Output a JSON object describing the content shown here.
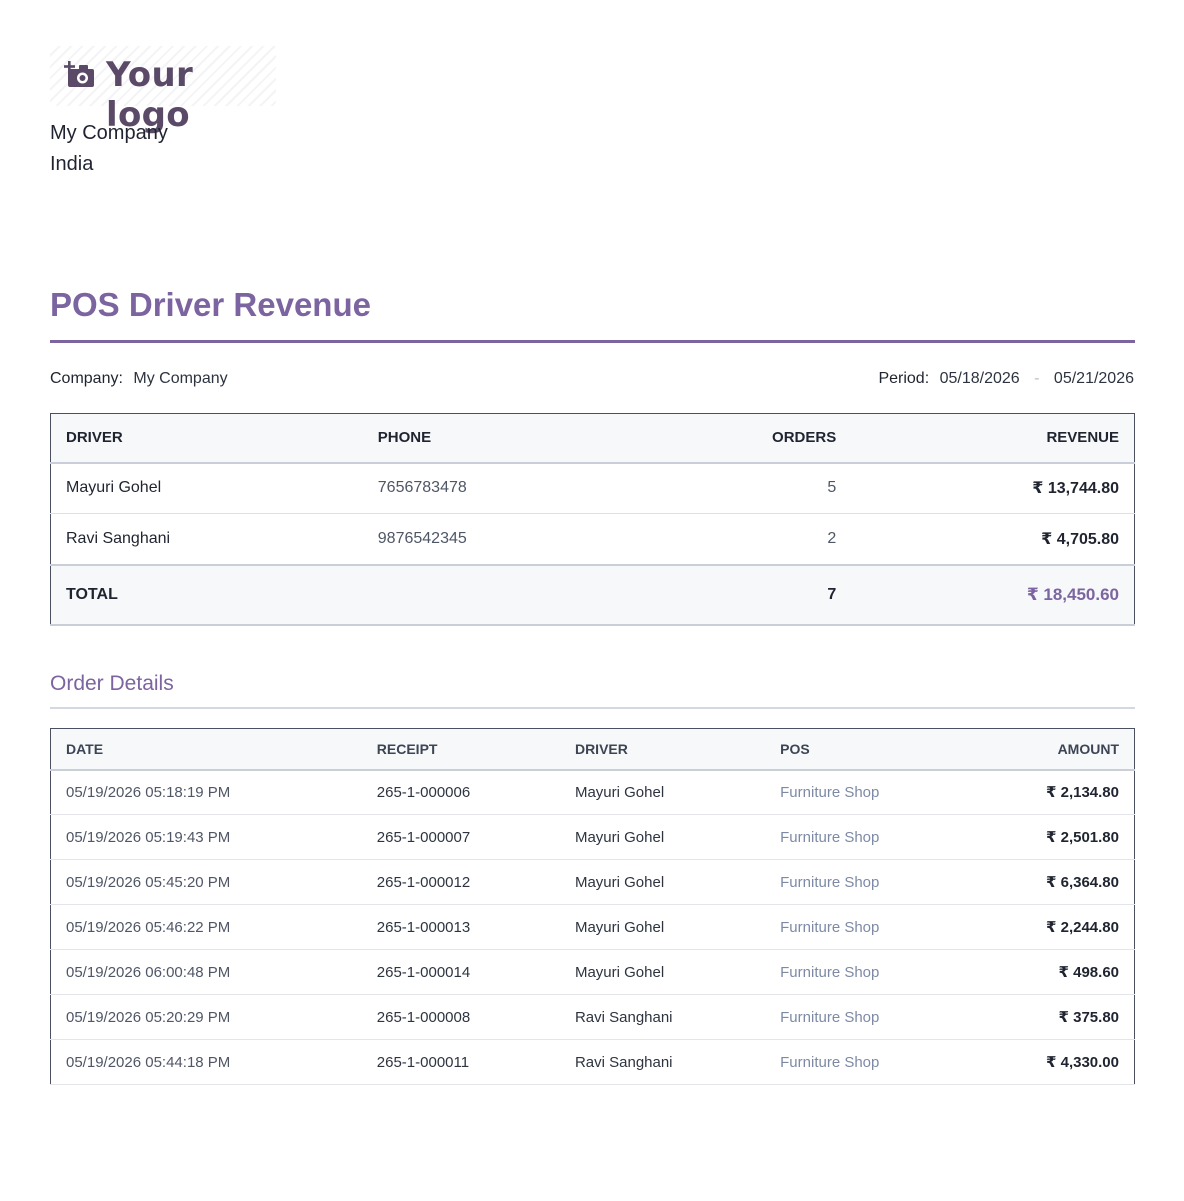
{
  "logo": {
    "text": "Your logo",
    "icon": "camera-plus-icon"
  },
  "company_block": {
    "name": "My Company",
    "country": "India"
  },
  "report": {
    "title": "POS Driver Revenue",
    "company_label": "Company:",
    "company_value": "My Company",
    "period_label": "Period:",
    "period_start": "05/18/2026",
    "period_separator": "-",
    "period_end": "05/21/2026"
  },
  "summary": {
    "headers": {
      "driver": "DRIVER",
      "phone": "PHONE",
      "orders": "ORDERS",
      "revenue": "REVENUE"
    },
    "rows": [
      {
        "driver": "Mayuri Gohel",
        "phone": "7656783478",
        "orders": "5",
        "revenue": "₹ 13,744.80"
      },
      {
        "driver": "Ravi Sanghani",
        "phone": "9876542345",
        "orders": "2",
        "revenue": "₹ 4,705.80"
      }
    ],
    "total": {
      "label": "TOTAL",
      "orders": "7",
      "revenue": "₹ 18,450.60"
    }
  },
  "details": {
    "title": "Order Details",
    "headers": {
      "date": "DATE",
      "receipt": "RECEIPT",
      "driver": "DRIVER",
      "pos": "POS",
      "amount": "AMOUNT"
    },
    "rows": [
      {
        "date": "05/19/2026 05:18:19 PM",
        "receipt": "265-1-000006",
        "driver": "Mayuri Gohel",
        "pos": "Furniture Shop",
        "amount": "₹ 2,134.80"
      },
      {
        "date": "05/19/2026 05:19:43 PM",
        "receipt": "265-1-000007",
        "driver": "Mayuri Gohel",
        "pos": "Furniture Shop",
        "amount": "₹ 2,501.80"
      },
      {
        "date": "05/19/2026 05:45:20 PM",
        "receipt": "265-1-000012",
        "driver": "Mayuri Gohel",
        "pos": "Furniture Shop",
        "amount": "₹ 6,364.80"
      },
      {
        "date": "05/19/2026 05:46:22 PM",
        "receipt": "265-1-000013",
        "driver": "Mayuri Gohel",
        "pos": "Furniture Shop",
        "amount": "₹ 2,244.80"
      },
      {
        "date": "05/19/2026 06:00:48 PM",
        "receipt": "265-1-000014",
        "driver": "Mayuri Gohel",
        "pos": "Furniture Shop",
        "amount": "₹ 498.60"
      },
      {
        "date": "05/19/2026 05:20:29 PM",
        "receipt": "265-1-000008",
        "driver": "Ravi Sanghani",
        "pos": "Furniture Shop",
        "amount": "₹ 375.80"
      },
      {
        "date": "05/19/2026 05:44:18 PM",
        "receipt": "265-1-000011",
        "driver": "Ravi Sanghani",
        "pos": "Furniture Shop",
        "amount": "₹ 4,330.00"
      }
    ]
  },
  "colors": {
    "accent": "#7b64a0",
    "logo": "#5a4a68",
    "pos_link": "#7d8aa6"
  }
}
